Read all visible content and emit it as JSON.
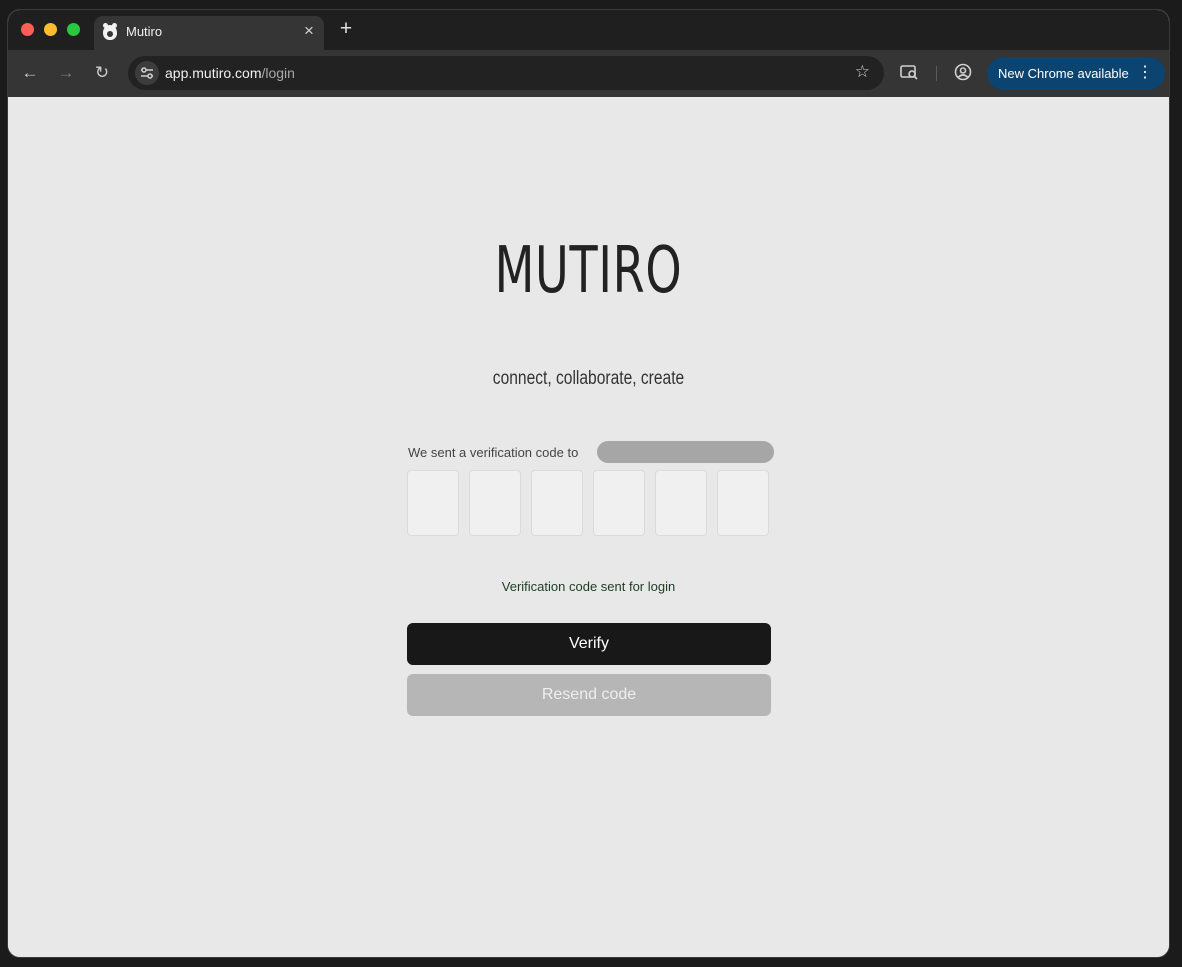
{
  "browser": {
    "tab_title": "Mutiro",
    "url_host": "app.mutiro.com",
    "url_path": "/login",
    "update_label": "New Chrome available"
  },
  "page": {
    "brand": "MUTIRO",
    "tagline": "connect, collaborate, create",
    "sent_text": "We sent a verification code to",
    "code_digits": [
      "",
      "",
      "",
      "",
      "",
      ""
    ],
    "status_message": "Verification code sent for login",
    "verify_label": "Verify",
    "resend_label": "Resend code"
  },
  "colors": {
    "accent_button": "#181818",
    "disabled_button": "#b6b6b6",
    "status_text": "#1e3d22",
    "chrome_update": "#0b4470"
  },
  "icons": {
    "back": "arrow-left",
    "forward": "arrow-right",
    "reload": "refresh",
    "site_info": "tune",
    "bookmark": "star",
    "search_tabs": "tab-search",
    "profile": "account-circle",
    "menu": "more-vert"
  }
}
